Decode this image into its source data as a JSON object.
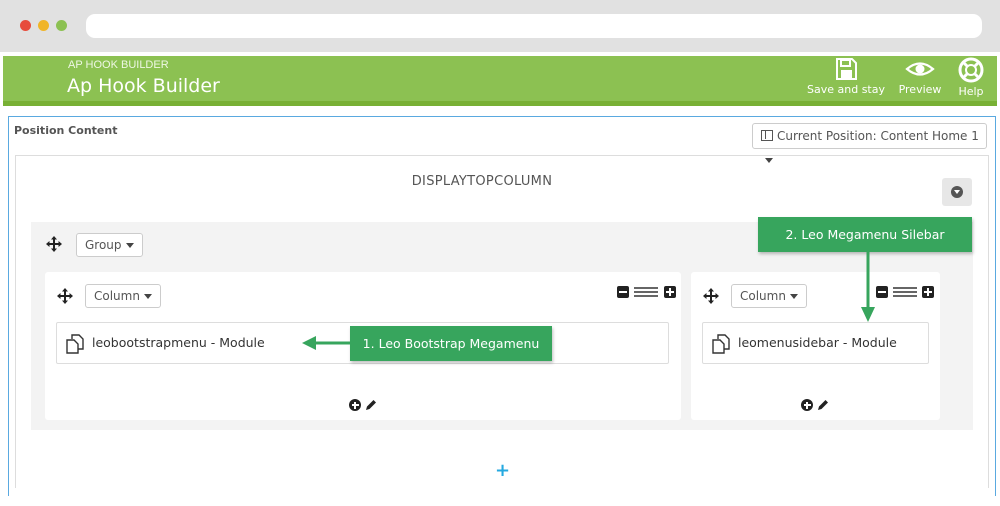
{
  "header": {
    "breadcrumb": "AP HOOK BUILDER",
    "title": "Ap Hook Builder",
    "actions": [
      {
        "label": "Save and stay",
        "icon": "floppy-disk-icon"
      },
      {
        "label": "Preview",
        "icon": "eye-icon"
      },
      {
        "label": "Help",
        "icon": "lifebuoy-icon"
      }
    ]
  },
  "panel": {
    "title": "Position Content",
    "position_select": "Current Position: Content Home 1"
  },
  "hook": {
    "name": "DISPLAYTOPCOLUMN",
    "group_label": "Group",
    "columns": [
      {
        "label": "Column",
        "module": "leobootstrapmenu - Module"
      },
      {
        "label": "Column",
        "module": "leomenusidebar - Module"
      }
    ]
  },
  "callouts": {
    "first": "1. Leo Bootstrap Megamenu",
    "second": "2. Leo Megamenu Silebar"
  },
  "colors": {
    "header_green": "#8cc152",
    "callout_green": "#37a55d",
    "panel_border": "#5aa9e0",
    "add_blue": "#25a9e0"
  }
}
